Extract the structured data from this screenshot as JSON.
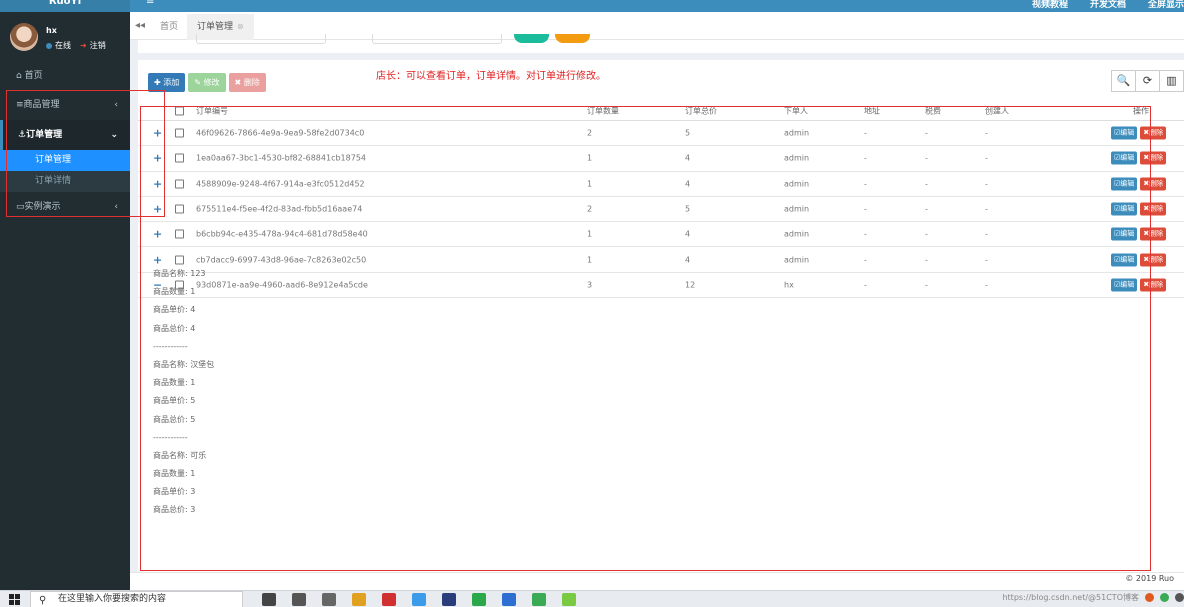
{
  "topbar": {
    "brand": "RuoYi",
    "menu_toggle": "≡",
    "links": [
      "视频教程",
      "开发文档",
      "全屏显示"
    ]
  },
  "user": {
    "name": "hx",
    "status": "在线",
    "logout": "注销"
  },
  "sidebar": {
    "home": "首页",
    "items": [
      {
        "label": "商品管理",
        "arrow": "‹"
      },
      {
        "label": "订单管理",
        "arrow": "⌄"
      },
      {
        "label": "实例演示",
        "arrow": "‹"
      }
    ],
    "sub_items": [
      {
        "label": "订单管理"
      },
      {
        "label": "订单详情"
      }
    ]
  },
  "tabs": {
    "back": "◂◂",
    "home": "首页",
    "active": "订单管理",
    "close": "⊗"
  },
  "toolbar": {
    "add": "✚ 添加",
    "edit": "✎ 修改",
    "delete": "✖ 删除",
    "note": "店长：可以查看订单，订单详情。对订单进行修改。",
    "search_icon": "🔍",
    "refresh_icon": "⟳",
    "columns_icon": "▥"
  },
  "table": {
    "headers": {
      "id": "订单编号",
      "qty": "订单数量",
      "total": "订单总价",
      "user": "下单人",
      "addr": "地址",
      "tax": "税费",
      "creator": "创建人",
      "ops": "操作"
    },
    "ops": {
      "edit": "☑编辑",
      "delete": "✖删除"
    },
    "rows": [
      {
        "expand": "+",
        "id": "46f09626-7866-4e9a-9ea9-58fe2d0734c0",
        "qty": "2",
        "total": "5",
        "user": "admin",
        "addr": "-",
        "tax": "-",
        "creator": "-"
      },
      {
        "expand": "+",
        "id": "1ea0aa67-3bc1-4530-bf82-68841cb18754",
        "qty": "1",
        "total": "4",
        "user": "admin",
        "addr": "-",
        "tax": "-",
        "creator": "-"
      },
      {
        "expand": "+",
        "id": "4588909e-9248-4f67-914a-e3fc0512d452",
        "qty": "1",
        "total": "4",
        "user": "admin",
        "addr": "-",
        "tax": "-",
        "creator": "-"
      },
      {
        "expand": "+",
        "id": "675511e4-f5ee-4f2d-83ad-fbb5d16aae74",
        "qty": "2",
        "total": "5",
        "user": "admin",
        "addr": "-",
        "tax": "-",
        "creator": "-"
      },
      {
        "expand": "+",
        "id": "b6cbb94c-e435-478a-94c4-681d78d58e40",
        "qty": "1",
        "total": "4",
        "user": "admin",
        "addr": "-",
        "tax": "-",
        "creator": "-"
      },
      {
        "expand": "+",
        "id": "cb7dacc9-6997-43d8-96ae-7c8263e02c50",
        "qty": "1",
        "total": "4",
        "user": "admin",
        "addr": "-",
        "tax": "-",
        "creator": "-"
      },
      {
        "expand": "−",
        "id": "93d0871e-aa9e-4960-aad6-8e912e4a5cde",
        "qty": "3",
        "total": "12",
        "user": "hx",
        "addr": "-",
        "tax": "-",
        "creator": "-"
      }
    ]
  },
  "detail_lines": [
    "商品名称: 123",
    "商品数量: 1",
    "商品单价: 4",
    "商品总价: 4",
    "------------",
    "商品名称: 汉堡包",
    "商品数量: 1",
    "商品单价: 5",
    "商品总价: 5",
    "------------",
    "商品名称: 可乐",
    "商品数量: 1",
    "商品单价: 3",
    "商品总价: 3"
  ],
  "footer": {
    "copyright": "© 2019 Ruo"
  },
  "taskbar": {
    "search_placeholder": "在这里输入你要搜索的内容",
    "icon_colors": [
      "#444444",
      "#555555",
      "#666666",
      "#e0a020",
      "#d03030",
      "#3c9be8",
      "#2a3d7a",
      "#2aa84a",
      "#2d6fd1",
      "#3aaa55",
      "#7ac943"
    ],
    "tray_text": "https://blog.csdn.net/@51CTO博客"
  }
}
